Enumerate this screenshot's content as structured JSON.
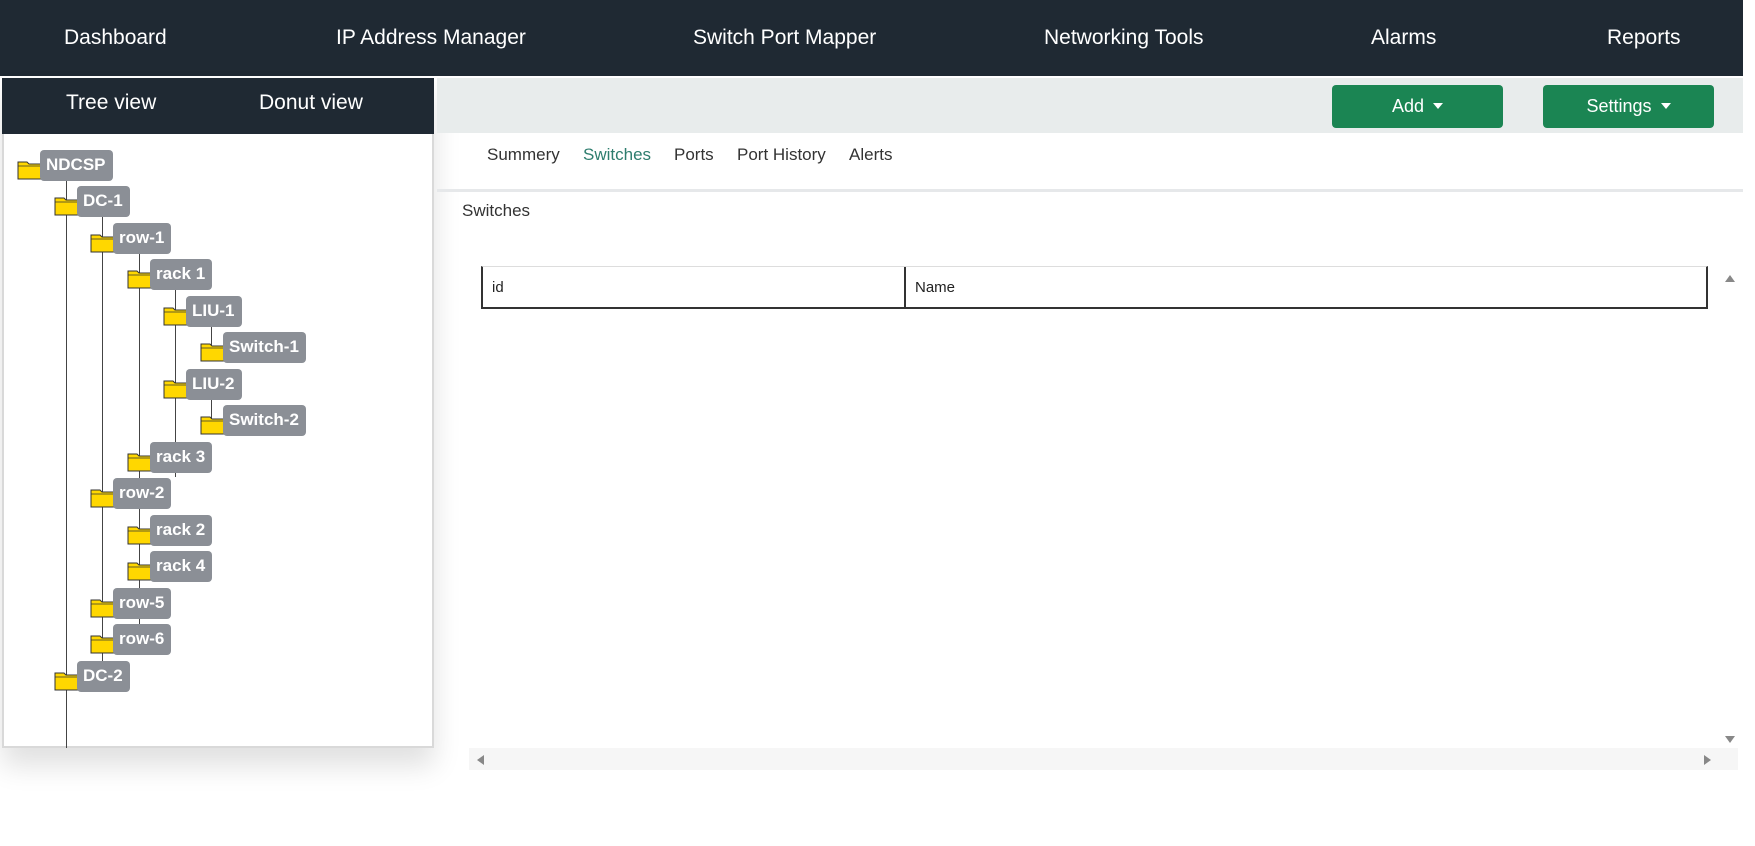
{
  "nav": {
    "items": [
      "Dashboard",
      "IP Address Manager",
      "Switch Port Mapper",
      "Networking Tools",
      "Alarms",
      "Reports"
    ]
  },
  "sidebar": {
    "tabs": [
      "Tree view",
      "Donut view"
    ],
    "tree": [
      "NDCSP",
      "DC-1",
      "row-1",
      "rack 1",
      "LIU-1",
      "Switch-1",
      "LIU-2",
      "Switch-2",
      "rack 3",
      "row-2",
      "rack 2",
      "rack 4",
      "row-5",
      "row-6",
      "DC-2"
    ]
  },
  "toolbar": {
    "add_label": "Add",
    "settings_label": "Settings"
  },
  "subtabs": {
    "items": [
      "Summery",
      "Switches",
      "Ports",
      "Port History",
      "Alerts"
    ],
    "active": "Switches"
  },
  "main": {
    "section_title": "Switches",
    "table": {
      "columns": [
        "id",
        "Name"
      ],
      "rows": []
    }
  },
  "colors": {
    "nav_bg": "#1f2933",
    "button_green": "#1b8553",
    "active_tab": "#2e7d6e",
    "tree_label_bg": "#8b8f96",
    "folder_yellow": "#ffd700"
  },
  "icons": [
    "folder-icon",
    "caret-down-icon",
    "scroll-up-arrow-icon",
    "scroll-down-arrow-icon",
    "scroll-left-arrow-icon",
    "scroll-right-arrow-icon"
  ]
}
